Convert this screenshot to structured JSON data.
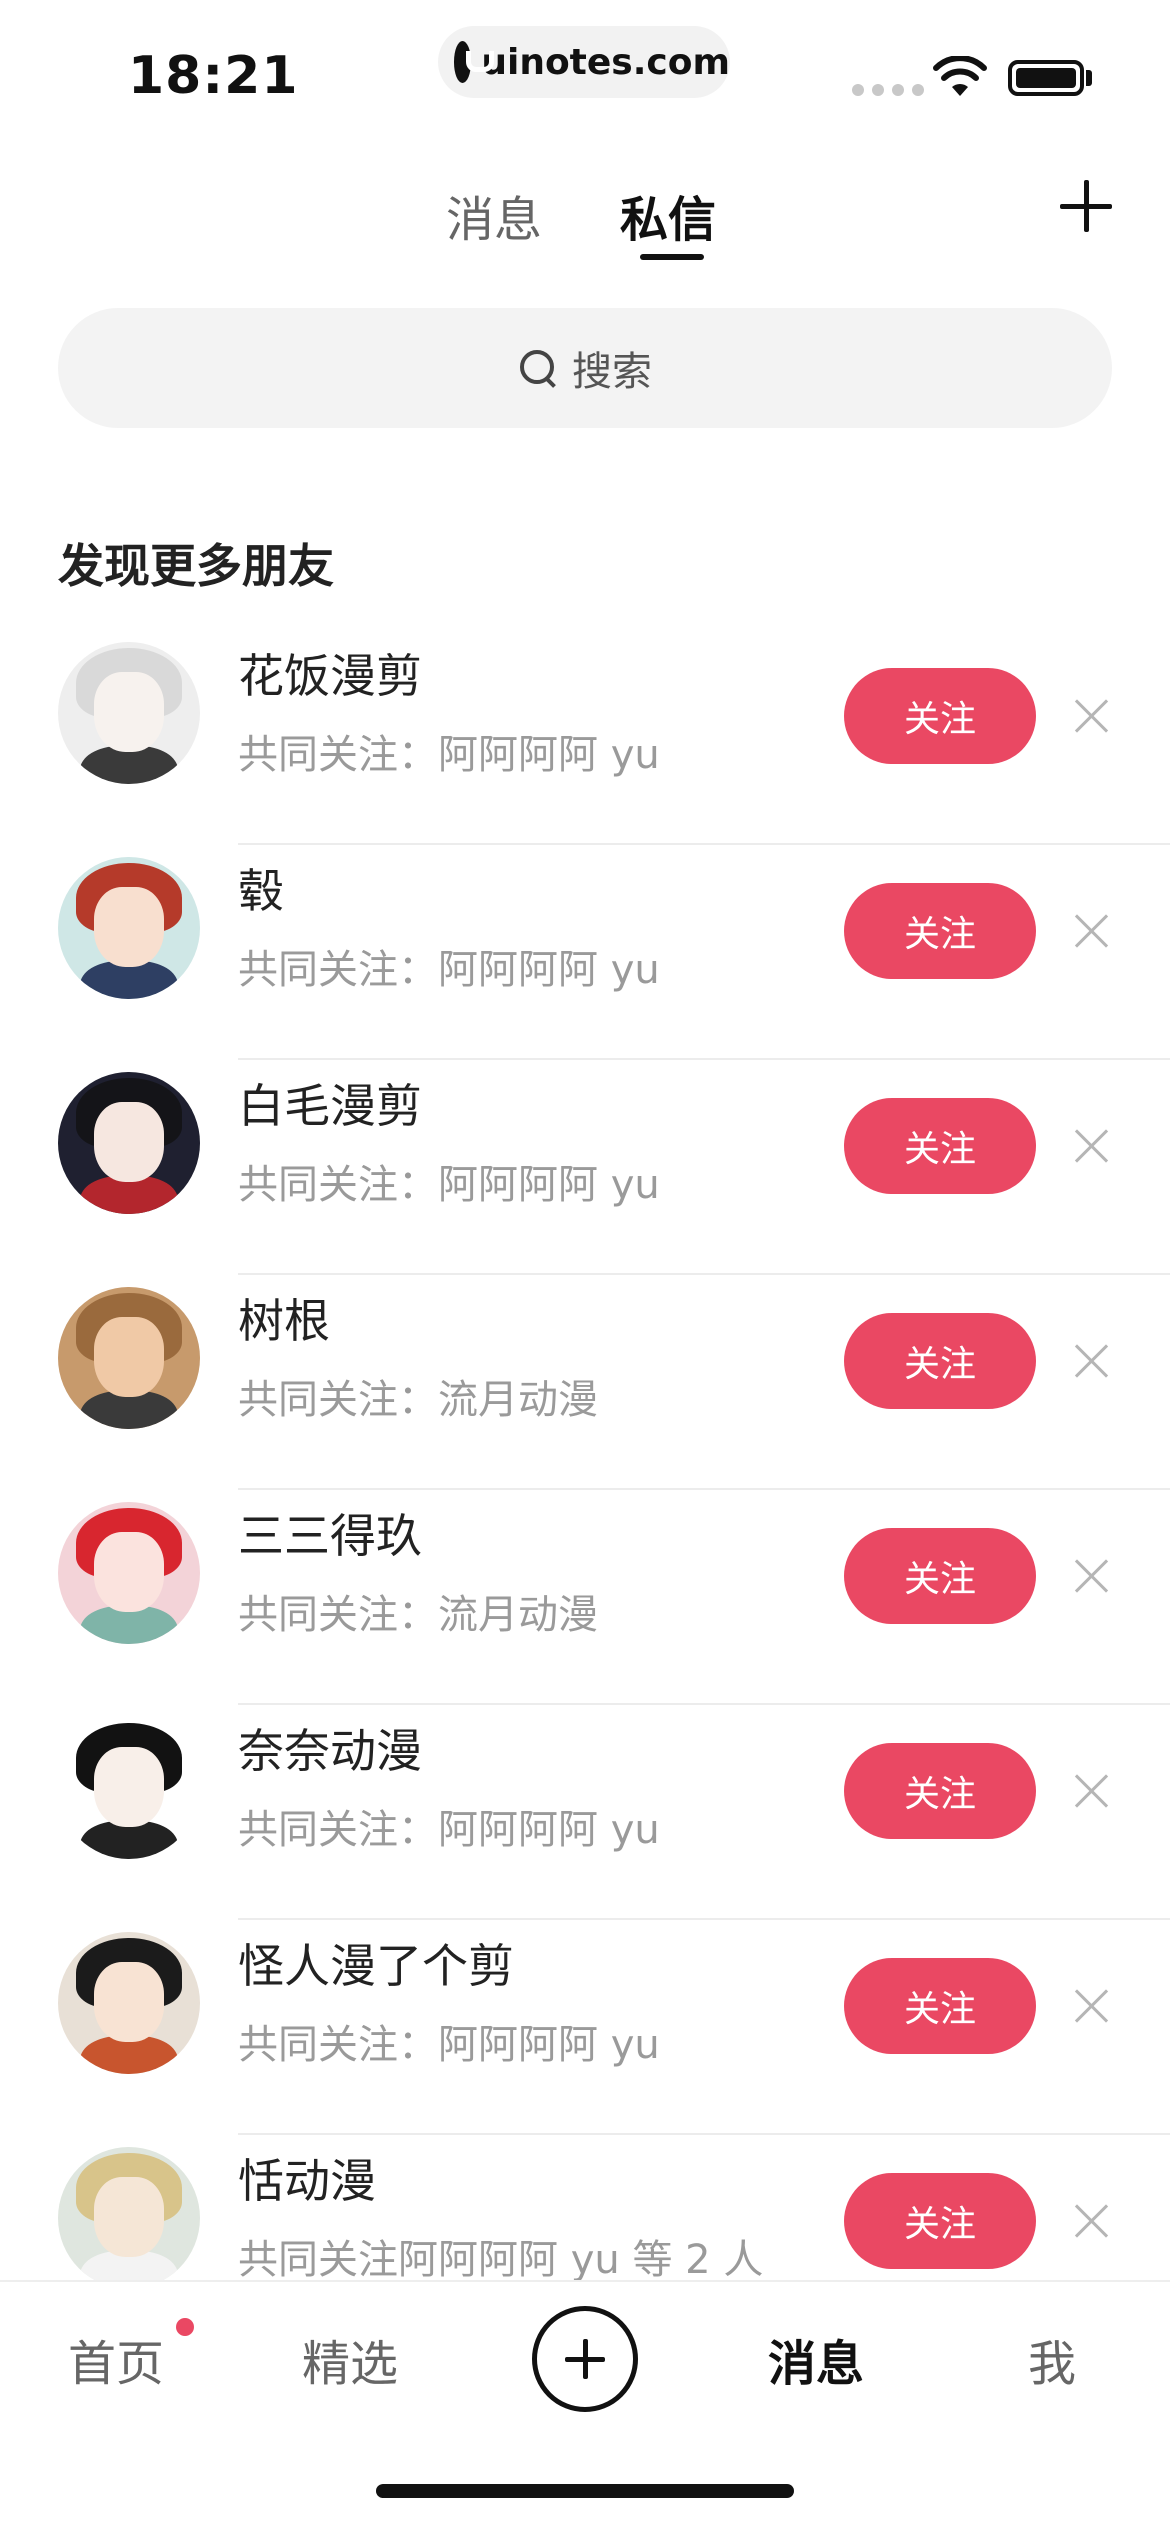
{
  "status_bar": {
    "time": "18:21",
    "url": "uinotes.com"
  },
  "top_tabs": {
    "messages": "消息",
    "dm": "私信",
    "active": "dm"
  },
  "search": {
    "placeholder": "搜索"
  },
  "section_title": "发现更多朋友",
  "follow_label": "关注",
  "friends": [
    {
      "name": "花饭漫剪",
      "mutual": "共同关注：阿阿阿阿 yu",
      "avatar": {
        "bg": "#eeeeee",
        "hair": "#d9d9d9",
        "face": "#f7f2ee",
        "body": "#3a3a3a"
      }
    },
    {
      "name": "毂",
      "mutual": "共同关注：阿阿阿阿 yu",
      "avatar": {
        "bg": "#cfe7e6",
        "hair": "#b53a2a",
        "face": "#f8dfcf",
        "body": "#2e3f63"
      }
    },
    {
      "name": "白毛漫剪",
      "mutual": "共同关注：阿阿阿阿 yu",
      "avatar": {
        "bg": "#1f2030",
        "hair": "#141418",
        "face": "#f6e7e0",
        "body": "#b3262d"
      }
    },
    {
      "name": "树根",
      "mutual": "共同关注：流月动漫",
      "avatar": {
        "bg": "#c79a6c",
        "hair": "#9a6a3d",
        "face": "#f0c9a6",
        "body": "#3a3a3a"
      }
    },
    {
      "name": "三三得玖",
      "mutual": "共同关注：流月动漫",
      "avatar": {
        "bg": "#f3d3d8",
        "hair": "#d8262f",
        "face": "#fbe3de",
        "body": "#7fb4a8"
      }
    },
    {
      "name": "奈奈动漫",
      "mutual": "共同关注：阿阿阿阿 yu",
      "avatar": {
        "bg": "#ffffff",
        "hair": "#121212",
        "face": "#f8efe9",
        "body": "#222222"
      }
    },
    {
      "name": "怪人漫了个剪",
      "mutual": "共同关注：阿阿阿阿 yu",
      "avatar": {
        "bg": "#e8e0d6",
        "hair": "#1b1b1b",
        "face": "#f8e3d3",
        "body": "#c8552e"
      }
    },
    {
      "name": "恬动漫",
      "mutual": "共同关注阿阿阿阿 yu 等 2 人",
      "avatar": {
        "bg": "#dfe6df",
        "hair": "#d8c48a",
        "face": "#f5e6d6",
        "body": "#f3f3f3"
      }
    }
  ],
  "bottom_nav": {
    "home": "首页",
    "featured": "精选",
    "messages": "消息",
    "me": "我"
  },
  "colors": {
    "accent": "#ea4863",
    "secondary_text": "#9a9a9a"
  }
}
